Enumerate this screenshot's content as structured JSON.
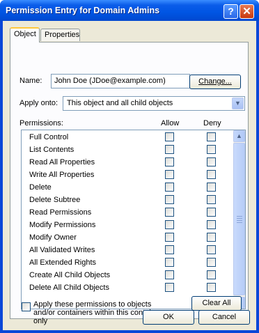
{
  "window": {
    "title": "Permission Entry for Domain Admins",
    "help_label": "?",
    "close_label": "✕"
  },
  "tabs": [
    {
      "label": "Object"
    },
    {
      "label": "Properties"
    }
  ],
  "name_row": {
    "label": "Name:",
    "value": "John Doe (JDoe@example.com)",
    "change_label": "Change..."
  },
  "apply_onto": {
    "label": "Apply onto:",
    "selected": "This object and all child objects"
  },
  "permissions": {
    "label": "Permissions:",
    "allow_header": "Allow",
    "deny_header": "Deny",
    "items": [
      {
        "name": "Full Control",
        "allow": false,
        "deny": false
      },
      {
        "name": "List Contents",
        "allow": false,
        "deny": false
      },
      {
        "name": "Read All Properties",
        "allow": false,
        "deny": false
      },
      {
        "name": "Write All Properties",
        "allow": false,
        "deny": false
      },
      {
        "name": "Delete",
        "allow": false,
        "deny": false
      },
      {
        "name": "Delete Subtree",
        "allow": false,
        "deny": false
      },
      {
        "name": "Read Permissions",
        "allow": false,
        "deny": false
      },
      {
        "name": "Modify Permissions",
        "allow": false,
        "deny": false
      },
      {
        "name": "Modify Owner",
        "allow": false,
        "deny": false
      },
      {
        "name": "All Validated Writes",
        "allow": false,
        "deny": false
      },
      {
        "name": "All Extended Rights",
        "allow": false,
        "deny": false
      },
      {
        "name": "Create All Child Objects",
        "allow": false,
        "deny": false
      },
      {
        "name": "Delete All Child Objects",
        "allow": false,
        "deny": false
      }
    ]
  },
  "apply_within": {
    "label": "Apply these permissions to objects and/or containers within this container only",
    "checked": false
  },
  "clear_all_label": "Clear All",
  "footer": {
    "ok_label": "OK",
    "cancel_label": "Cancel"
  }
}
